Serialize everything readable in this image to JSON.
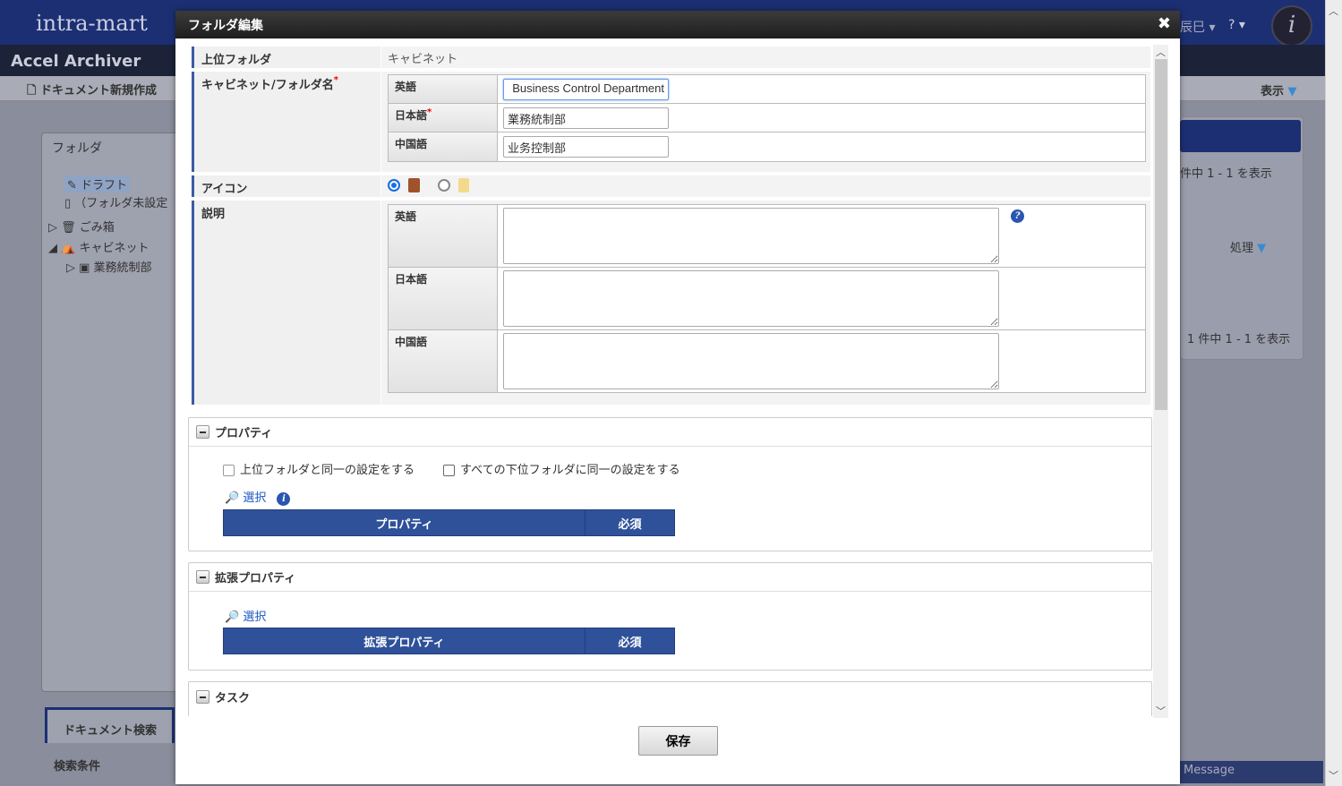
{
  "background": {
    "logo": "intra-mart",
    "app_name": "Accel Archiver",
    "new_document": "ドキュメント新規作成",
    "view_menu": "表示",
    "user_menu": "辰巳",
    "help_menu": "?",
    "folder_panel_title": "フォルダ",
    "tree": [
      "ドラフト",
      "（フォルダ未設定",
      "ごみ箱",
      "キャビネット",
      "業務統制部"
    ],
    "count_text_1": "件中 1 - 1 を表示",
    "count_text_2": "1 件中 1 - 1 を表示",
    "process_menu": "処理",
    "search_tab": "ドキュメント検索",
    "search_conditions": "検索条件",
    "message": "Message"
  },
  "dialog": {
    "title": "フォルダ編集",
    "parent_folder_label": "上位フォルダ",
    "parent_folder_value": "キャビネット",
    "name_label": "キャビネット/フォルダ名",
    "name_rows": [
      {
        "lang": "英語",
        "value": "Business Control Department",
        "required": false
      },
      {
        "lang": "日本語",
        "value": "業務統制部",
        "required": true
      },
      {
        "lang": "中国語",
        "value": "业务控制部",
        "required": false
      }
    ],
    "icon_label": "アイコン",
    "icon_options": [
      {
        "name": "cabinet",
        "selected": true
      },
      {
        "name": "folder",
        "selected": false
      }
    ],
    "description_label": "説明",
    "description_rows": [
      {
        "lang": "英語",
        "value": ""
      },
      {
        "lang": "日本語",
        "value": ""
      },
      {
        "lang": "中国語",
        "value": ""
      }
    ],
    "property_section": {
      "title": "プロパティ",
      "checkbox_same_as_parent": "上位フォルダと同一の設定をする",
      "checkbox_apply_children": "すべての下位フォルダに同一の設定をする",
      "select_link": "選択",
      "columns": [
        "プロパティ",
        "必須"
      ]
    },
    "ext_property_section": {
      "title": "拡張プロパティ",
      "select_link": "選択",
      "columns": [
        "拡張プロパティ",
        "必須"
      ]
    },
    "task_section": {
      "title": "タスク"
    },
    "save_button": "保存"
  }
}
